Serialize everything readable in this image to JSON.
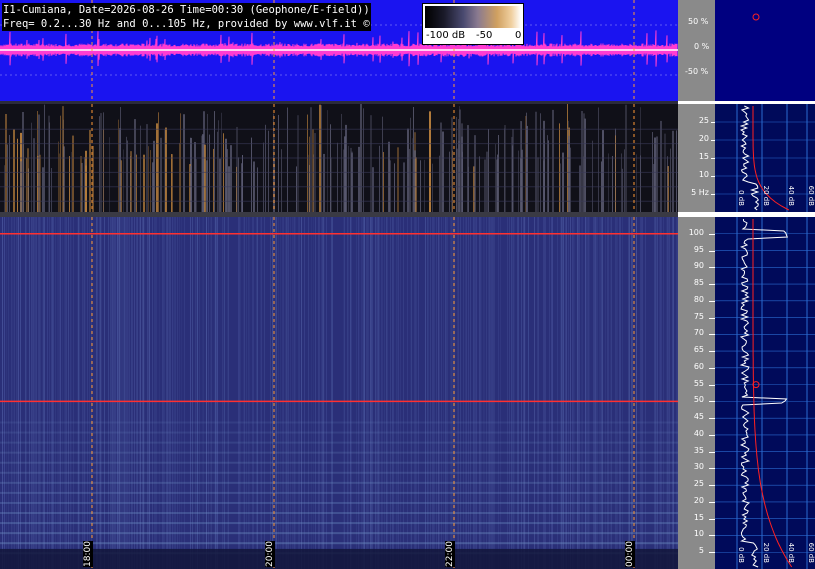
{
  "header": {
    "line1": "I1-Cumiana, Date=2026-08-26 Time=00:30 (Geophone/E-field))",
    "line2": "Freq= 0.2...30 Hz and 0...105 Hz, provided by www.vlf.it ©"
  },
  "colorbar": {
    "labels": [
      "-100 dB",
      "-50",
      "0"
    ]
  },
  "waveform_axis": {
    "ticks": [
      "50 %",
      "0 %",
      "-50 %"
    ]
  },
  "spectrogram_low_axis": {
    "ticks": [
      "25",
      "20",
      "15",
      "10",
      "5 Hz"
    ]
  },
  "spectrogram_high_axis": {
    "ticks": [
      "100",
      "95",
      "90",
      "85",
      "80",
      "75",
      "70",
      "65",
      "60",
      "55",
      "50",
      "45",
      "40",
      "35",
      "30",
      "25",
      "20",
      "15",
      "10",
      "5"
    ]
  },
  "time_labels": [
    "18:00",
    "20:00",
    "22:00",
    "00:00"
  ],
  "side_panel_low": {
    "ticks": [
      "0 dB",
      "20 dB",
      "40 dB",
      "60 dB"
    ]
  },
  "side_panel_high": {
    "ticks": [
      "0 dB",
      "20 dB",
      "40 dB",
      "60 dB"
    ]
  },
  "colors": {
    "waveform_bg": "#1a14f0",
    "waveform_trace": "#ff3cd2",
    "marker_line": "#ff9933",
    "hum_line": "#ff3030"
  },
  "chart_data": [
    {
      "type": "line",
      "title": "",
      "xlabel": "",
      "ylabel": "",
      "x": [
        "18:00",
        "20:00",
        "22:00",
        "00:00"
      ],
      "ylim": [
        -100,
        100
      ],
      "yticks": [
        50,
        0,
        -50
      ],
      "yunit": "%",
      "grid": true
    },
    {
      "type": "heatmap",
      "title": "",
      "x": [
        "18:00",
        "20:00",
        "22:00",
        "00:00"
      ],
      "ylim": [
        0,
        30
      ],
      "yticks": [
        25,
        20,
        15,
        10,
        5
      ],
      "yunit": "Hz",
      "color_scale_db": [
        -100,
        0
      ]
    },
    {
      "type": "heatmap",
      "title": "",
      "x": [
        "18:00",
        "20:00",
        "22:00",
        "00:00"
      ],
      "ylim": [
        0,
        105
      ],
      "yticks": [
        100,
        95,
        90,
        85,
        80,
        75,
        70,
        65,
        60,
        55,
        50,
        45,
        40,
        35,
        30,
        25,
        20,
        15,
        10,
        5
      ],
      "highlighted_lines_hz": [
        100,
        50
      ]
    }
  ]
}
